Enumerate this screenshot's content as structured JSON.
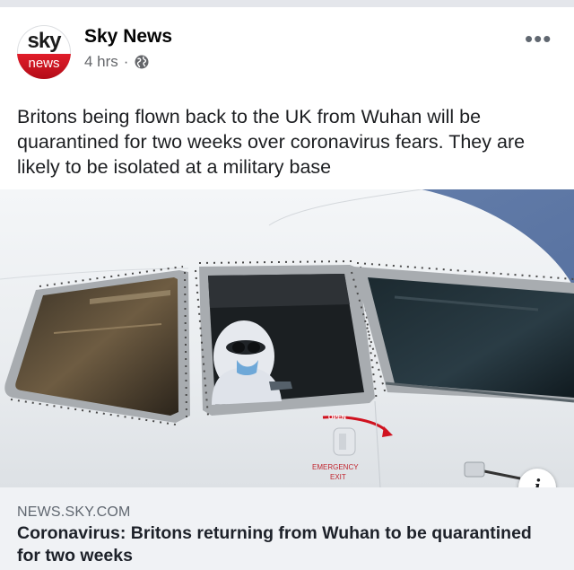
{
  "post": {
    "page_name": "Sky News",
    "time": "4 hrs",
    "separator": "·",
    "privacy_icon": "globe-icon",
    "more_icon": "more-options-icon",
    "more_label": "•••",
    "caption": "Britons being flown back to the UK from Wuhan will be quarantined for two weeks over coronavirus fears. They are likely to be isolated at a military base"
  },
  "avatar": {
    "logo_top": "sky",
    "logo_bottom": "news"
  },
  "photo": {
    "open_label": "OPEN",
    "exit_label_1": "EMERGENCY",
    "exit_label_2": "EXIT",
    "info_label": "i"
  },
  "link": {
    "domain": "NEWS.SKY.COM",
    "headline": "Coronavirus: Britons returning from Wuhan to be quarantined for two weeks"
  },
  "colors": {
    "brand_red": "#d0121f",
    "meta_gray": "#65676b",
    "link_bg": "#f0f2f5"
  }
}
